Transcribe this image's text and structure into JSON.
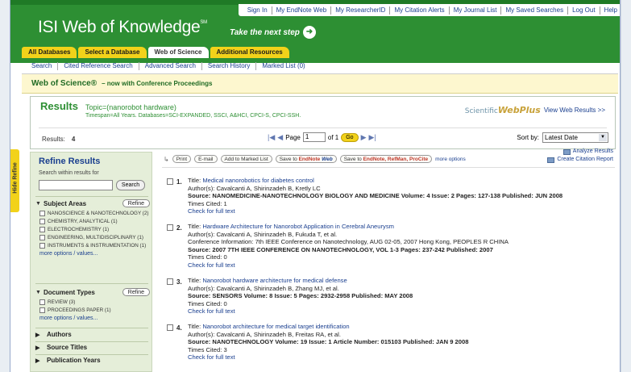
{
  "toplinks": [
    "Sign In",
    "My EndNote Web",
    "My ResearcherID",
    "My Citation Alerts",
    "My Journal List",
    "My Saved Searches",
    "Log Out",
    "Help"
  ],
  "logo": {
    "text": "ISI Web of Knowledge",
    "mark": "SM"
  },
  "tagline": "Take the next step",
  "tabs": [
    "All Databases",
    "Select a Database",
    "Web of Science",
    "Additional Resources"
  ],
  "subnav": [
    "Search",
    "Cited Reference Search",
    "Advanced Search",
    "Search History",
    "Marked List (0)"
  ],
  "banner": {
    "title": "Web of Science®",
    "subtitle": "– now with Conference Proceedings"
  },
  "results": {
    "title": "Results",
    "topic": "Topic=(nanorobot hardware)",
    "timespan": "Timespan=All Years. Databases=SCI-EXPANDED, SSCI, A&HCI, CPCI-S, CPCI-SSH.",
    "webplus_brand_a": "Scientific",
    "webplus_brand_b": "WebPlus",
    "webplus_link": "View Web Results >>",
    "count_label": "Results:",
    "count": "4",
    "page_label": "Page",
    "page_value": "1",
    "of_label": "of 1",
    "go": "Go",
    "sort_label": "Sort by:",
    "sort_value": "Latest Date"
  },
  "sidebar": {
    "hide": "Hide Refine",
    "title": "Refine Results",
    "within": "Search within results for",
    "search_btn": "Search",
    "subject": {
      "title": "Subject Areas",
      "refine": "Refine",
      "options": [
        "NANOSCIENCE & NANOTECHNOLOGY (2)",
        "CHEMISTRY, ANALYTICAL (1)",
        "ELECTROCHEMISTRY (1)",
        "ENGINEERING, MULTIDISCIPLINARY (1)",
        "INSTRUMENTS & INSTRUMENTATION (1)"
      ],
      "more": "more options / values..."
    },
    "doctypes": {
      "title": "Document Types",
      "refine": "Refine",
      "options": [
        "REVIEW (3)",
        "PROCEEDINGS PAPER (1)"
      ],
      "more": "more options / values..."
    },
    "collapsed": [
      "Authors",
      "Source Titles",
      "Publication Years"
    ]
  },
  "toolbar": {
    "print": "Print",
    "email": "E-mail",
    "marked": "Add to Marked List",
    "save_en_a": "Save to ",
    "save_en_b": "EndNote",
    "save_en_c": " Web",
    "save_ref_a": "Save to ",
    "save_ref_b": "EndNote, RefMan, ProCite",
    "more": "more options",
    "analyze": "Analyze Results",
    "citation": "Create Citation Report"
  },
  "records": [
    {
      "num": "1.",
      "title_label": "Title:",
      "title": "Medical nanorobotics for diabetes control",
      "authors": "Author(s): Cavalcanti A, Shirinzadeh B, Kretly LC",
      "source": "Source: NANOMEDICINE-NANOTECHNOLOGY BIOLOGY AND MEDICINE  Volume: 4  Issue: 2  Pages: 127-138  Published: JUN 2008",
      "conference": "",
      "cited": "Times Cited: 1",
      "fulltext": "Check for full text"
    },
    {
      "num": "2.",
      "title_label": "Title:",
      "title": "Hardware Architecture for Nanorobot Application in Cerebral Aneurysm",
      "authors": "Author(s): Cavalcanti A, Shirinzadeh B, Fukuda T, et al.",
      "conference": "Conference Information: 7th IEEE Conference on Nanotechnology, AUG 02-05, 2007 Hong Kong, PEOPLES R CHINA",
      "source": "Source: 2007 7TH IEEE CONFERENCE ON NANOTECHNOLOGY, VOL 1-3  Pages: 237-242  Published: 2007",
      "cited": "Times Cited: 0",
      "fulltext": "Check for full text"
    },
    {
      "num": "3.",
      "title_label": "Title:",
      "title": "Nanorobot hardware architecture for medical defense",
      "authors": "Author(s): Cavalcanti A, Shirinzadeh B, Zhang MJ, et al.",
      "conference": "",
      "source": "Source: SENSORS  Volume: 8  Issue: 5  Pages: 2932-2958  Published: MAY 2008",
      "cited": "Times Cited: 0",
      "fulltext": "Check for full text"
    },
    {
      "num": "4.",
      "title_label": "Title:",
      "title": "Nanorobot architecture for medical target identification",
      "authors": "Author(s): Cavalcanti A, Shirinzadeh B, Freitas RA, et al.",
      "conference": "",
      "source": "Source: NANOTECHNOLOGY  Volume: 19  Issue: 1  Article Number: 015103  Published: JAN 9 2008",
      "cited": "Times Cited: 3",
      "fulltext": "Check for full text"
    }
  ]
}
